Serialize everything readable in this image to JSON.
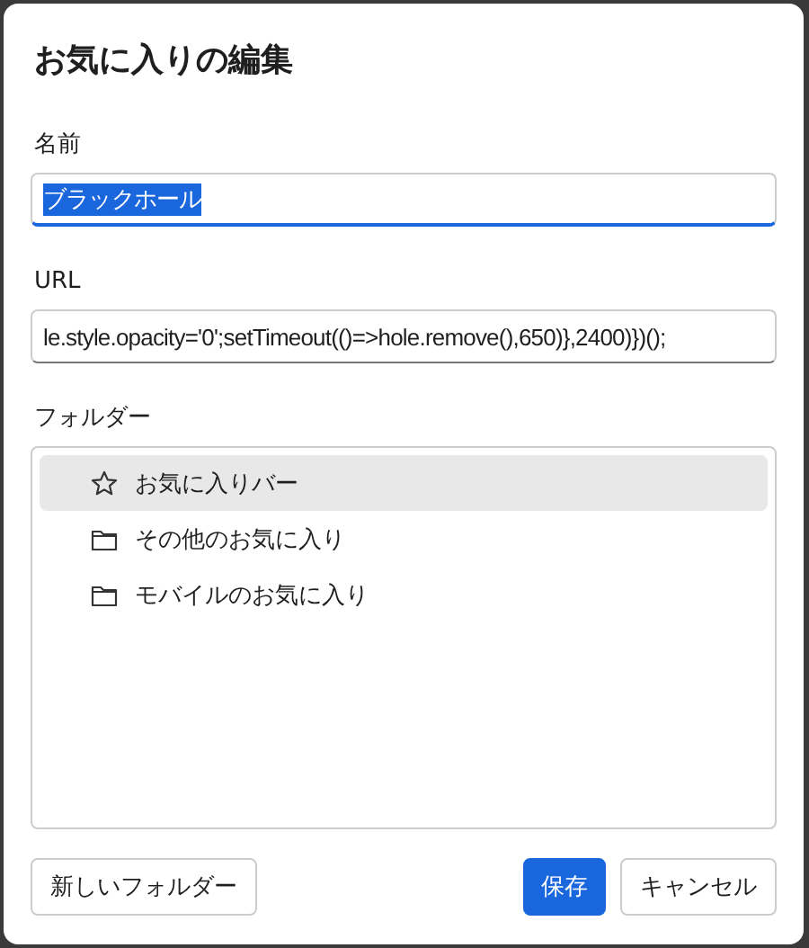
{
  "dialog": {
    "title": "お気に入りの編集"
  },
  "name_field": {
    "label": "名前",
    "value": "ブラックホール",
    "focused": true,
    "text_selected": true
  },
  "url_field": {
    "label": "URL",
    "value": "le.style.opacity='0';setTimeout(()=>hole.remove(),650)},2400)})();",
    "focused": false,
    "text_selected": false
  },
  "folders": {
    "label": "フォルダー",
    "items": [
      {
        "kind": "star",
        "label": "お気に入りバー",
        "selected": true
      },
      {
        "kind": "folder",
        "label": "その他のお気に入り",
        "selected": false
      },
      {
        "kind": "folder",
        "label": "モバイルのお気に入り",
        "selected": false
      }
    ]
  },
  "buttons": {
    "new_folder": "新しいフォルダー",
    "save": "保存",
    "cancel": "キャンセル"
  }
}
